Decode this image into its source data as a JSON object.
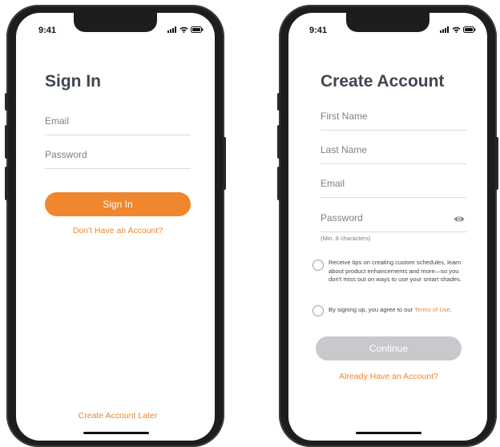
{
  "status_bar": {
    "time": "9:41"
  },
  "sign_in": {
    "title": "Sign In",
    "email_placeholder": "Email",
    "password_placeholder": "Password",
    "sign_in_button": "Sign In",
    "no_account_link": "Don't Have an Account?",
    "create_later_link": "Create Account Later"
  },
  "create_account": {
    "title": "Create Account",
    "first_name_placeholder": "First Name",
    "last_name_placeholder": "Last Name",
    "email_placeholder": "Email",
    "password_placeholder": "Password",
    "password_hint": "(Min. 8 characters)",
    "tips_checkbox_text": "Receive tips on creating custom schedules, learn about product enhancements and more—so you don't miss out on ways to use your smart shades.",
    "terms_prefix": "By signing up, you agree to our ",
    "terms_link": "Terms of Use",
    "terms_suffix": ".",
    "continue_button": "Continue",
    "have_account_link": "Already Have an Account?"
  },
  "colors": {
    "accent": "#f0862d",
    "disabled_button": "#c8c9cc",
    "title_text": "#3f4650"
  },
  "icons": [
    "signal-icon",
    "wifi-icon",
    "battery-icon",
    "eye-icon"
  ]
}
